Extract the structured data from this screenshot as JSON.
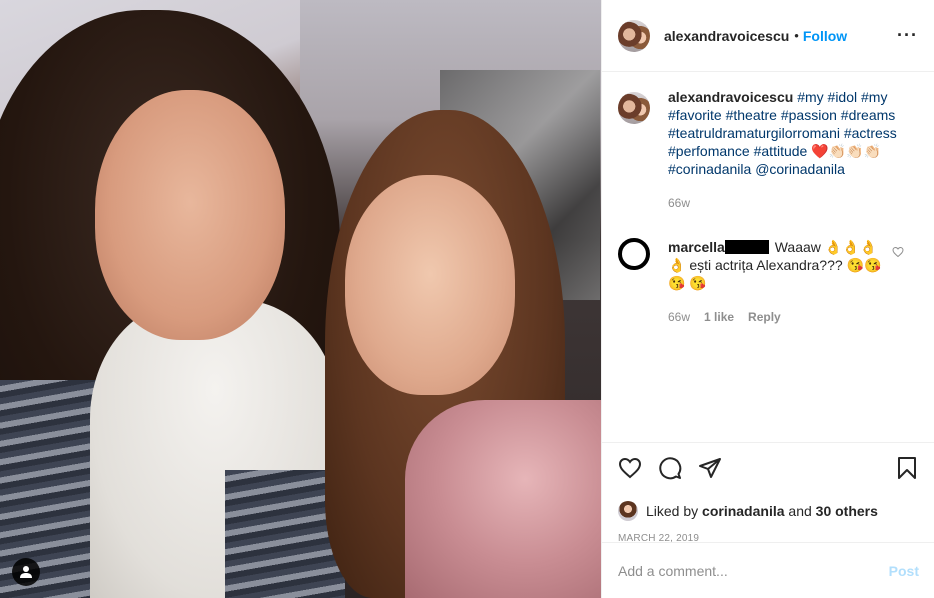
{
  "post": {
    "username": "alexandravoicescu",
    "follow_label": "Follow",
    "separator": "•",
    "more_icon": "more-icon"
  },
  "caption": {
    "username": "alexandravoicescu",
    "text_parts": [
      "#my",
      "#idol",
      "#my",
      "#favorite",
      "#theatre",
      "#passion",
      "#dreams",
      "#teatruldramaturgilorromani",
      "#actress",
      "#perfomance",
      "#attitude"
    ],
    "emojis": "❤️👏🏻👏🏻👏🏻",
    "tags2": [
      "#corinadanila",
      "@corinadanila"
    ],
    "age": "66w"
  },
  "comment": {
    "username": "marcella",
    "text": "Waaaw 👌👌👌👌 ești actrița Alexandra??? 😘😘😘 😘",
    "age": "66w",
    "likes": "1 like",
    "reply": "Reply"
  },
  "actions": {
    "liked_prefix": "Liked by",
    "liked_user": "corinadanila",
    "liked_and": "and",
    "liked_others": "30 others",
    "date": "MARCH 22, 2019"
  },
  "add_comment": {
    "placeholder": "Add a comment...",
    "post_label": "Post"
  },
  "colors": {
    "accent": "#0095f6",
    "hashtag": "#00376b",
    "muted": "#8e8e8e",
    "post_disabled": "#b2dffc"
  }
}
